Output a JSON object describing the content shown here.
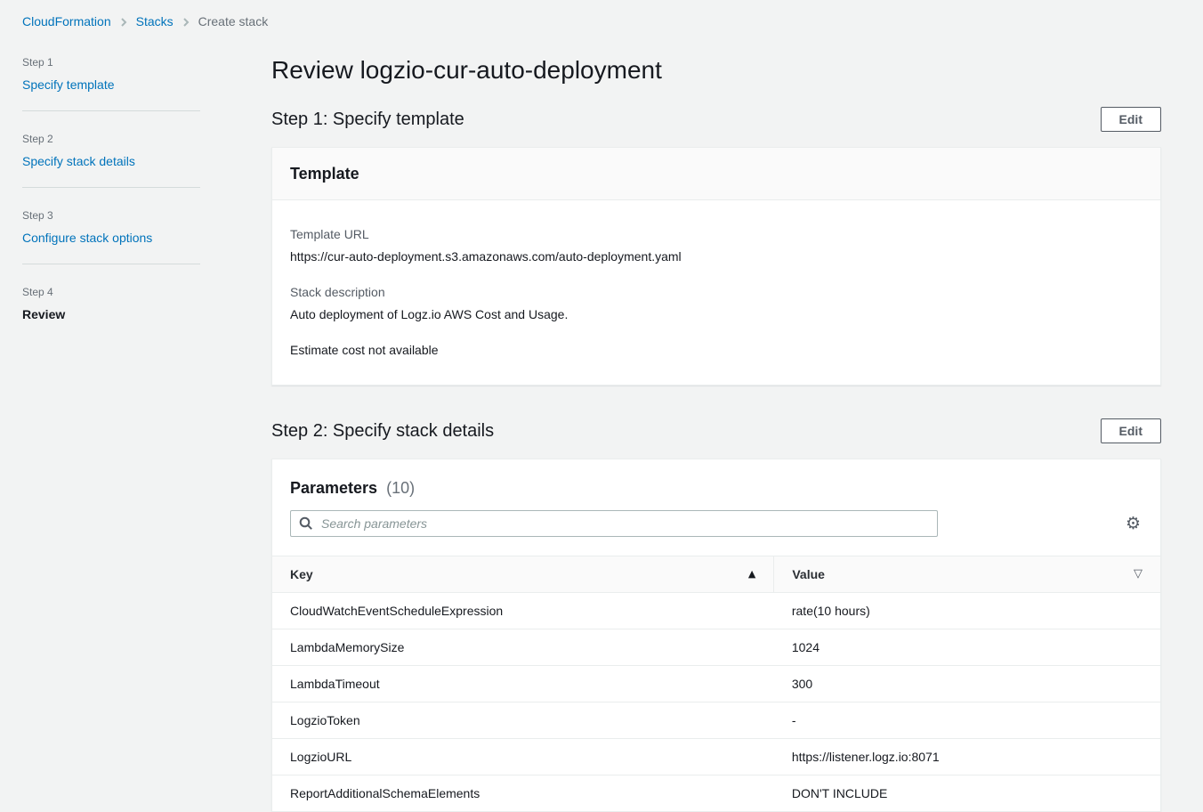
{
  "breadcrumb": {
    "items": [
      {
        "label": "CloudFormation"
      },
      {
        "label": "Stacks"
      },
      {
        "label": "Create stack"
      }
    ]
  },
  "sidebar": {
    "steps": [
      {
        "step": "Step 1",
        "label": "Specify template"
      },
      {
        "step": "Step 2",
        "label": "Specify stack details"
      },
      {
        "step": "Step 3",
        "label": "Configure stack options"
      },
      {
        "step": "Step 4",
        "label": "Review"
      }
    ]
  },
  "page": {
    "title": "Review logzio-cur-auto-deployment"
  },
  "step1_section": {
    "heading": "Step 1: Specify template",
    "edit_button": "Edit",
    "template_card": {
      "title": "Template",
      "template_url_label": "Template URL",
      "template_url_value": "https://cur-auto-deployment.s3.amazonaws.com/auto-deployment.yaml",
      "stack_description_label": "Stack description",
      "stack_description_value": "Auto deployment of Logz.io AWS Cost and Usage.",
      "estimate_note": "Estimate cost not available"
    }
  },
  "step2_section": {
    "heading": "Step 2: Specify stack details",
    "edit_button": "Edit",
    "parameters_card": {
      "title": "Parameters",
      "count": "(10)",
      "search_placeholder": "Search parameters",
      "table": {
        "columns": [
          {
            "label": "Key"
          },
          {
            "label": "Value"
          }
        ],
        "rows": [
          {
            "key": "CloudWatchEventScheduleExpression",
            "value": "rate(10 hours)"
          },
          {
            "key": "LambdaMemorySize",
            "value": "1024"
          },
          {
            "key": "LambdaTimeout",
            "value": "300"
          },
          {
            "key": "LogzioToken",
            "value": "-"
          },
          {
            "key": "LogzioURL",
            "value": "https://listener.logz.io:8071"
          },
          {
            "key": "ReportAdditionalSchemaElements",
            "value": "DON'T INCLUDE"
          }
        ]
      }
    }
  },
  "icons": {
    "breadcrumb_separator": "chevron-right",
    "search": "magnifier",
    "settings_gear_glyph": "⚙",
    "sort_ascending_glyph": "▲",
    "sort_indicator_glyph": "▽"
  },
  "colors": {
    "link_blue": "#0073bb",
    "text_dark": "#16191f",
    "text_gray": "#687078",
    "label_gray": "#545b64",
    "page_bg": "#f2f3f3",
    "card_header_bg": "#fafafa",
    "border": "#eaeded",
    "input_border": "#aab7b8"
  }
}
